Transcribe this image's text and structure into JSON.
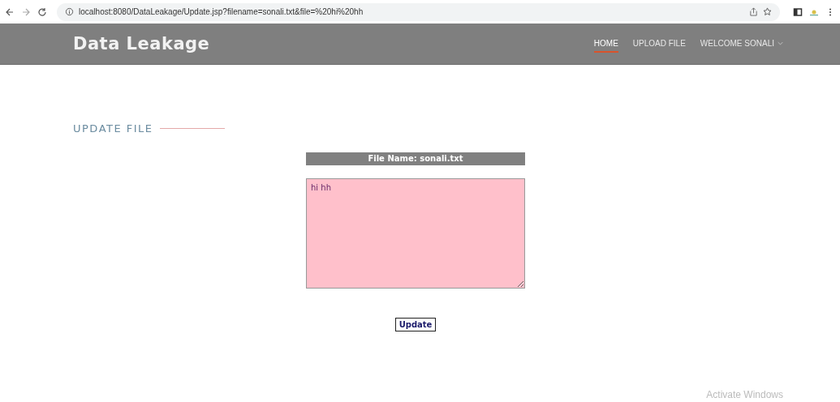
{
  "browser": {
    "url": "localhost:8080/DataLeakage/Update.jsp?filename=sonali.txt&file=%20hi%20hh"
  },
  "header": {
    "brand": "Data Leakage",
    "nav": [
      {
        "label": "HOME",
        "selected": true,
        "dropdown": false
      },
      {
        "label": "UPLOAD FILE",
        "selected": false,
        "dropdown": false
      },
      {
        "label": "WELCOME SONALI",
        "selected": false,
        "dropdown": true
      }
    ]
  },
  "section_title": "UPDATE FILE",
  "form": {
    "file_name": "File Name: sonali.txt",
    "content": "hi hh",
    "button": "Update"
  },
  "os_notice": "Activate Windows"
}
